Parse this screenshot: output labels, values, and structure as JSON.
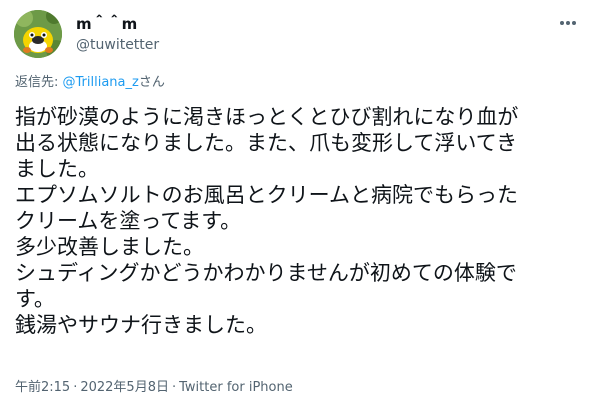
{
  "author": {
    "display_name": "m＾＾m",
    "handle": "@tuwitetter"
  },
  "reply": {
    "prefix": "返信先: ",
    "mention": "@Trilliana_z",
    "suffix": "さん"
  },
  "tweet_lines": [
    "指が砂漠のように渇きほっとくとひび割れになり血が",
    "出る状態になりました。また、爪も変形して浮いてき",
    "ました。",
    "エプソムソルトのお風呂とクリームと病院でもらった",
    "クリームを塗ってます。",
    "多少改善しました。",
    "シュディングかどうかわかりませんが初めての体験で",
    "す。",
    "銭湯やサウナ行きました。"
  ],
  "meta": {
    "time": "午前2:15",
    "date": "2022年5月8日",
    "separator": "·",
    "source": "Twitter for iPhone"
  },
  "icons": {
    "more": "more-options-icon",
    "avatar": "cartoon-bird-avatar"
  },
  "colors": {
    "text": "#0f1419",
    "secondary": "#536471",
    "link": "#1d9bf0"
  }
}
